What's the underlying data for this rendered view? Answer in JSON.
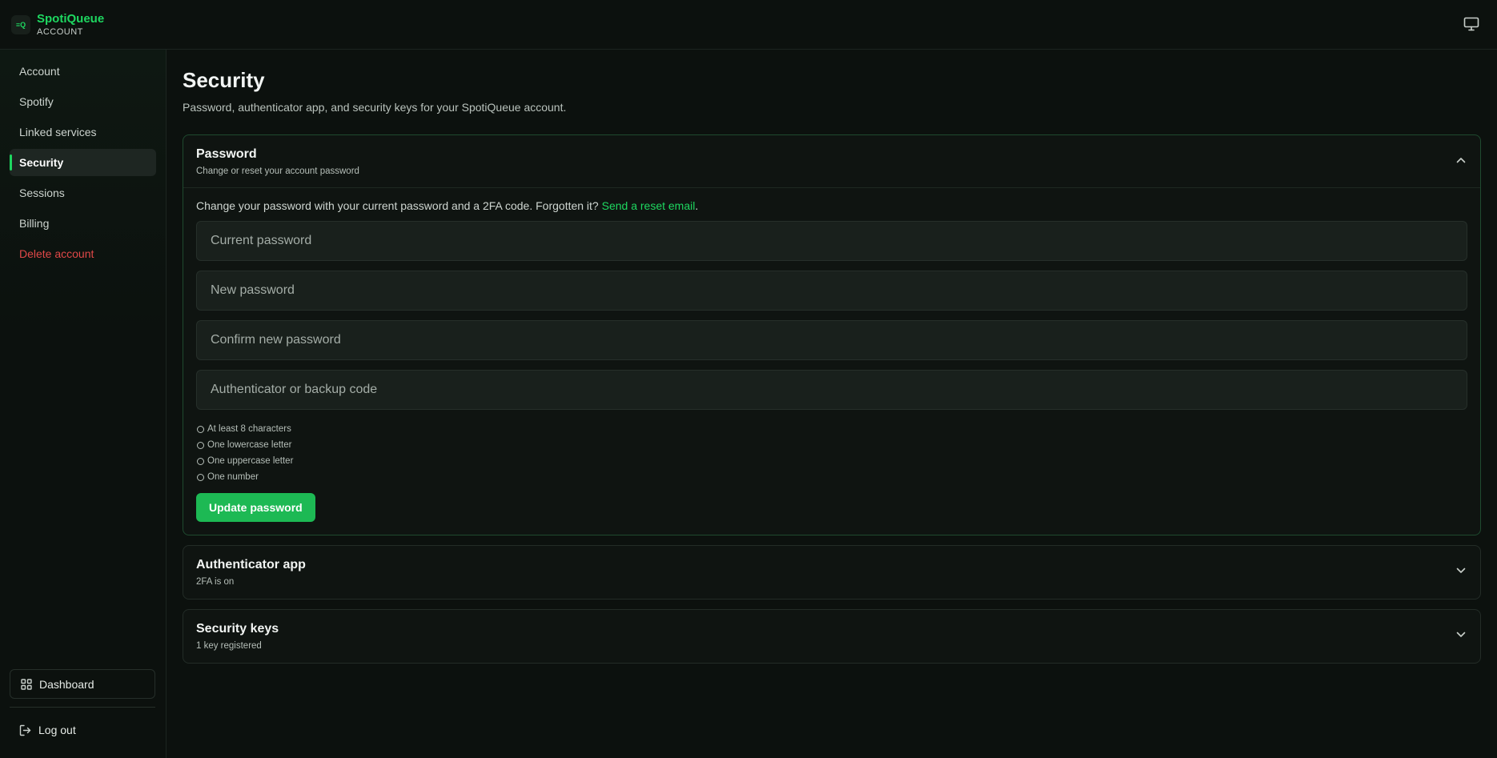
{
  "app": {
    "name": "SpotiQueue",
    "section": "ACCOUNT",
    "logo_text": "≡Q"
  },
  "sidebar": {
    "items": [
      {
        "label": "Account"
      },
      {
        "label": "Spotify"
      },
      {
        "label": "Linked services"
      },
      {
        "label": "Security",
        "active": true
      },
      {
        "label": "Sessions"
      },
      {
        "label": "Billing"
      },
      {
        "label": "Delete account",
        "danger": true
      }
    ],
    "dashboard_label": "Dashboard",
    "logout_label": "Log out"
  },
  "page": {
    "title": "Security",
    "subtitle": "Password, authenticator app, and security keys for your SpotiQueue account."
  },
  "password_card": {
    "title": "Password",
    "subtitle": "Change or reset your account password",
    "intro_text": "Change your password with your current password and a 2FA code. Forgotten it? ",
    "reset_link": "Send a reset email",
    "intro_end": ".",
    "fields": {
      "current": "Current password",
      "new": "New password",
      "confirm": "Confirm new password",
      "code": "Authenticator or backup code"
    },
    "requirements": [
      "At least 8 characters",
      "One lowercase letter",
      "One uppercase letter",
      "One number"
    ],
    "submit_label": "Update password"
  },
  "auth_card": {
    "title": "Authenticator app",
    "subtitle": "2FA is on"
  },
  "keys_card": {
    "title": "Security keys",
    "subtitle": "1 key registered"
  },
  "colors": {
    "accent": "#1ed760",
    "button": "#1db954",
    "danger": "#e04848",
    "background": "#0c110e"
  }
}
